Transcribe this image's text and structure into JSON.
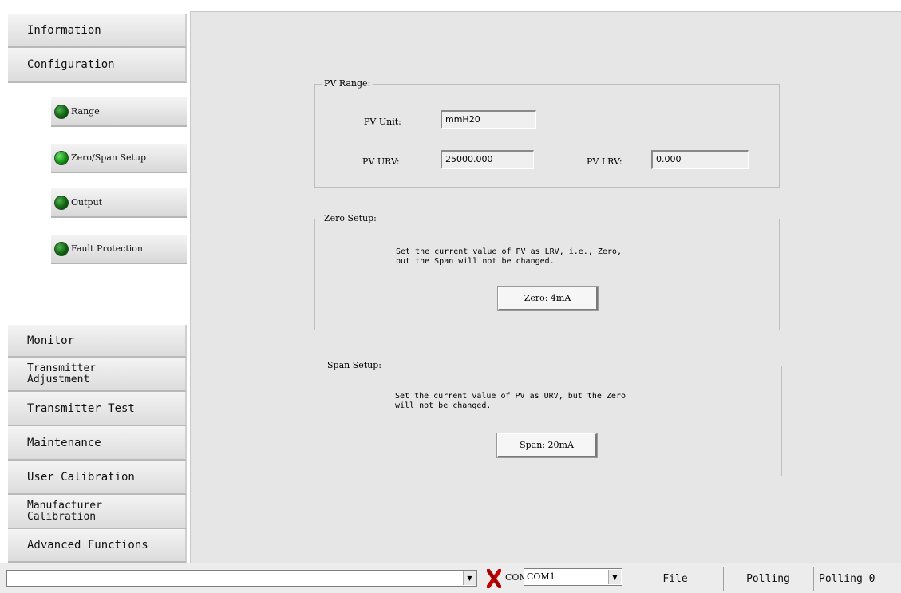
{
  "sidebar": {
    "information": "Information",
    "configuration": "Configuration",
    "sub_items": [
      "Range",
      "Zero/Span Setup",
      "Output",
      "Fault Protection"
    ],
    "monitor": "Monitor",
    "transmitter_adjustment": "Transmitter\nAdjustment",
    "transmitter_test": "Transmitter Test",
    "maintenance": "Maintenance",
    "user_calibration": "User Calibration",
    "manufacturer_calibration": "Manufacturer\nCalibration",
    "advanced_functions": "Advanced Functions"
  },
  "pv_range": {
    "title": "PV Range:",
    "unit_label": "PV Unit:",
    "unit_value": "mmH20",
    "urv_label": "PV URV:",
    "urv_value": "25000.000",
    "lrv_label": "PV LRV:",
    "lrv_value": "0.000"
  },
  "zero_setup": {
    "title": "Zero Setup:",
    "description": "Set the current value of PV as LRV, i.e., Zero,\nbut the Span will not be changed.",
    "button": "Zero: 4mA"
  },
  "span_setup": {
    "title": "Span Setup:",
    "description": "Set the current value of PV as URV, but the Zero\nwill not be changed.",
    "button": "Span: 20mA"
  },
  "statusbar": {
    "com_label": "COM:",
    "com_value": "COM1",
    "file": "File",
    "polling": "Polling",
    "polling_count": "Polling 0"
  },
  "icons": {
    "status_led": "green-led-icon",
    "disconnect": "red-x-icon",
    "dropdown": "chevron-down-icon"
  },
  "colors": {
    "led_green": "#0d8a0d",
    "disconnect_red": "#c00000",
    "panel_bg": "#e6e6e6"
  }
}
